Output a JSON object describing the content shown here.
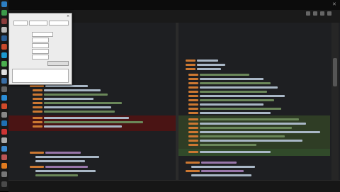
{
  "window": {
    "title": "",
    "close_glyph": "✕"
  },
  "tabs": [],
  "dialog": {
    "title": "",
    "close_glyph": "×",
    "rows": [],
    "buttons": []
  },
  "status": {
    "left": "",
    "right": ""
  },
  "colors": {
    "deleted": "#4a1414",
    "added": "#2f3d25",
    "keyword": "#cc7832",
    "string": "#6a8759"
  }
}
